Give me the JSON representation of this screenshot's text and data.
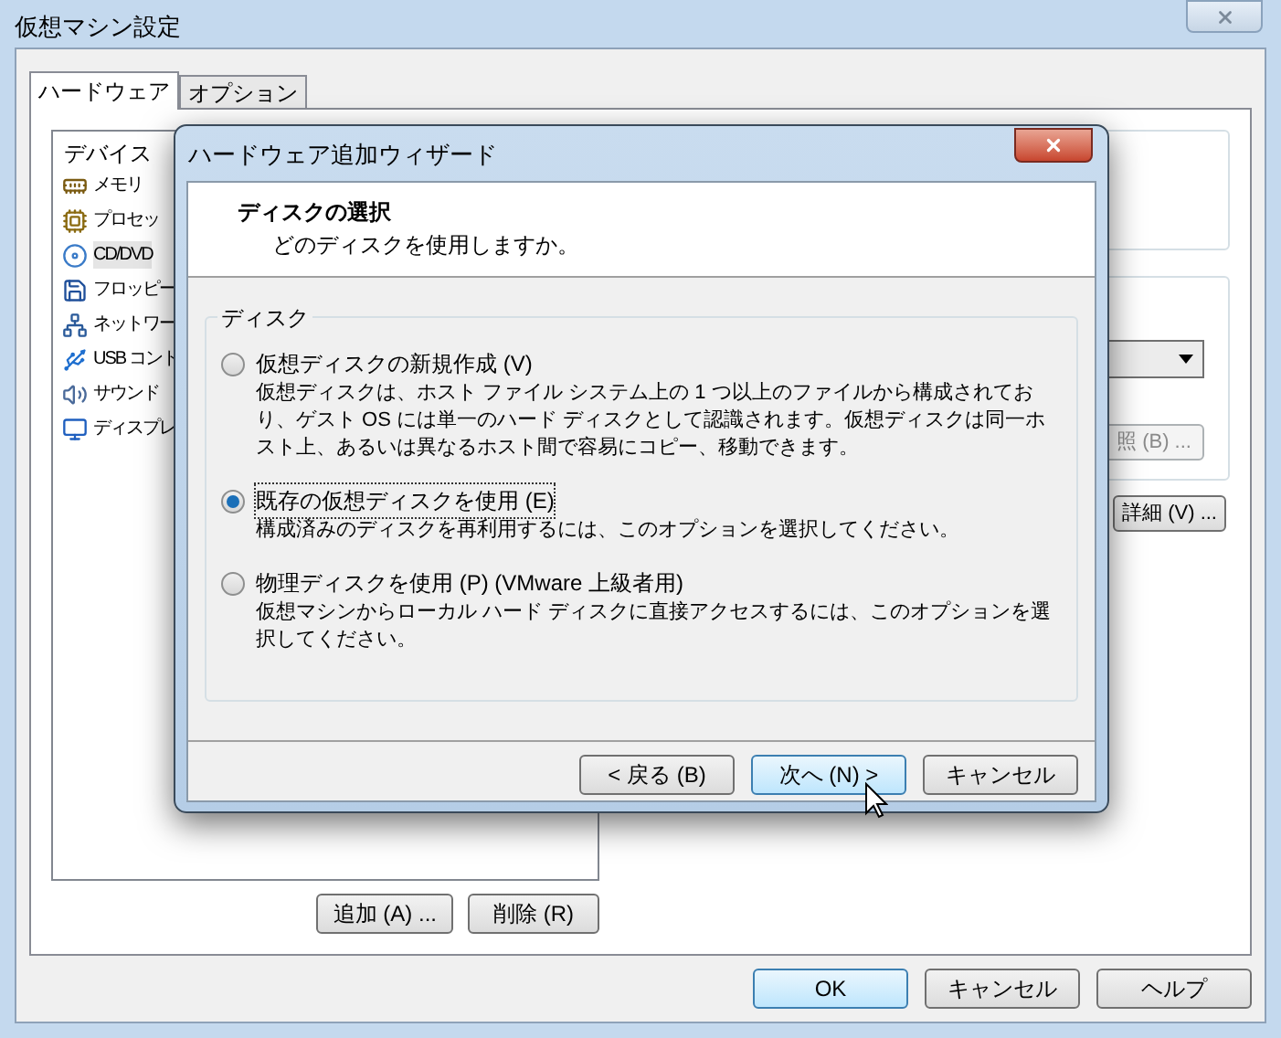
{
  "window": {
    "title": "仮想マシン設定"
  },
  "tabs": [
    {
      "label": "ハードウェア",
      "selected": true
    },
    {
      "label": "オプション",
      "selected": false
    }
  ],
  "device_list": {
    "header": "デバイス",
    "items": [
      {
        "kind": "memory",
        "label": "メモリ",
        "selected": false
      },
      {
        "kind": "processor",
        "label": "プロセッ",
        "selected": false
      },
      {
        "kind": "cd",
        "label": "CD/DVD",
        "selected": true
      },
      {
        "kind": "floppy",
        "label": "フロッピー",
        "selected": false
      },
      {
        "kind": "network",
        "label": "ネットワー",
        "selected": false
      },
      {
        "kind": "usb",
        "label": "USB コント",
        "selected": false
      },
      {
        "kind": "sound",
        "label": "サウンド",
        "selected": false
      },
      {
        "kind": "display",
        "label": "ディスプレ",
        "selected": false
      }
    ]
  },
  "right_panel": {
    "browse_button": {
      "label": "照 (B) ...",
      "disabled": true
    },
    "advanced_button": {
      "label": "詳細 (V) ...",
      "disabled": false
    }
  },
  "list_buttons": [
    {
      "label": "追加 (A) ..."
    },
    {
      "label": "削除 (R)"
    }
  ],
  "buttons": [
    {
      "label": "OK",
      "default": true
    },
    {
      "label": "キャンセル",
      "default": false
    },
    {
      "label": "ヘルプ",
      "default": false
    }
  ],
  "dialog": {
    "title": "ハードウェア追加ウィザード",
    "heading": "ディスクの選択",
    "subheading": "どのディスクを使用しますか。",
    "group_label": "ディスク",
    "options": [
      {
        "label": "仮想ディスクの新規作成 (V)",
        "description": "仮想ディスクは、ホスト ファイル システム上の 1 つ以上のファイルから構成されており、ゲスト OS には単一のハード ディスクとして認識されます。仮想ディスクは同一ホスト上、あるいは異なるホスト間で容易にコピー、移動できます。",
        "selected": false
      },
      {
        "label": "既存の仮想ディスクを使用 (E)",
        "description": "構成済みのディスクを再利用するには、このオプションを選択してください。",
        "selected": true
      },
      {
        "label": "物理ディスクを使用 (P) (VMware 上級者用)",
        "description": "仮想マシンからローカル ハード ディスクに直接アクセスするには、このオプションを選択してください。",
        "selected": false
      }
    ],
    "buttons": [
      {
        "label": "< 戻る (B)",
        "default": false
      },
      {
        "label": "次へ (N) >",
        "default": true
      },
      {
        "label": "キャンセル",
        "default": false
      }
    ]
  }
}
